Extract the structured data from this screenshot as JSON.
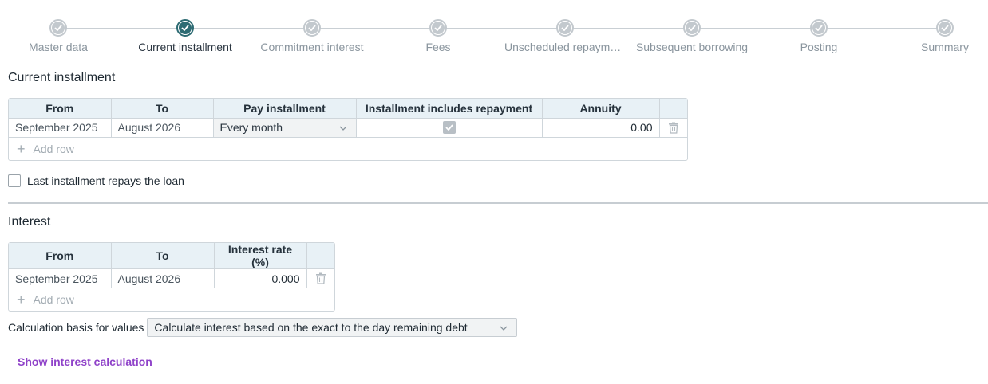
{
  "stepper": {
    "steps": [
      {
        "label": "Master data",
        "active": false
      },
      {
        "label": "Current installment",
        "active": true
      },
      {
        "label": "Commitment interest",
        "active": false
      },
      {
        "label": "Fees",
        "active": false
      },
      {
        "label": "Unscheduled repayme…",
        "active": false
      },
      {
        "label": "Subsequent borrowing",
        "active": false
      },
      {
        "label": "Posting",
        "active": false
      },
      {
        "label": "Summary",
        "active": false
      }
    ]
  },
  "installment": {
    "title": "Current installment",
    "columns": [
      "From",
      "To",
      "Pay installment",
      "Installment includes repayment",
      "Annuity"
    ],
    "rows": [
      {
        "from": "September 2025",
        "to": "August 2026",
        "pay": "Every month",
        "includes_repayment": true,
        "annuity": "0.00"
      }
    ],
    "add_row_label": "Add row"
  },
  "last_installment": {
    "label": "Last installment repays the loan",
    "checked": false
  },
  "interest": {
    "title": "Interest",
    "columns": [
      "From",
      "To",
      "Interest rate (%)"
    ],
    "rows": [
      {
        "from": "September 2025",
        "to": "August 2026",
        "rate": "0.000"
      }
    ],
    "add_row_label": "Add row"
  },
  "calculation": {
    "label": "Calculation basis for values",
    "selected": "Calculate interest based on the exact to the day remaining debt"
  },
  "show_interest_link": "Show interest calculation",
  "colors": {
    "accent": "#2d6b73",
    "link": "#8f42c9",
    "header_bg": "#e8f1f6"
  }
}
